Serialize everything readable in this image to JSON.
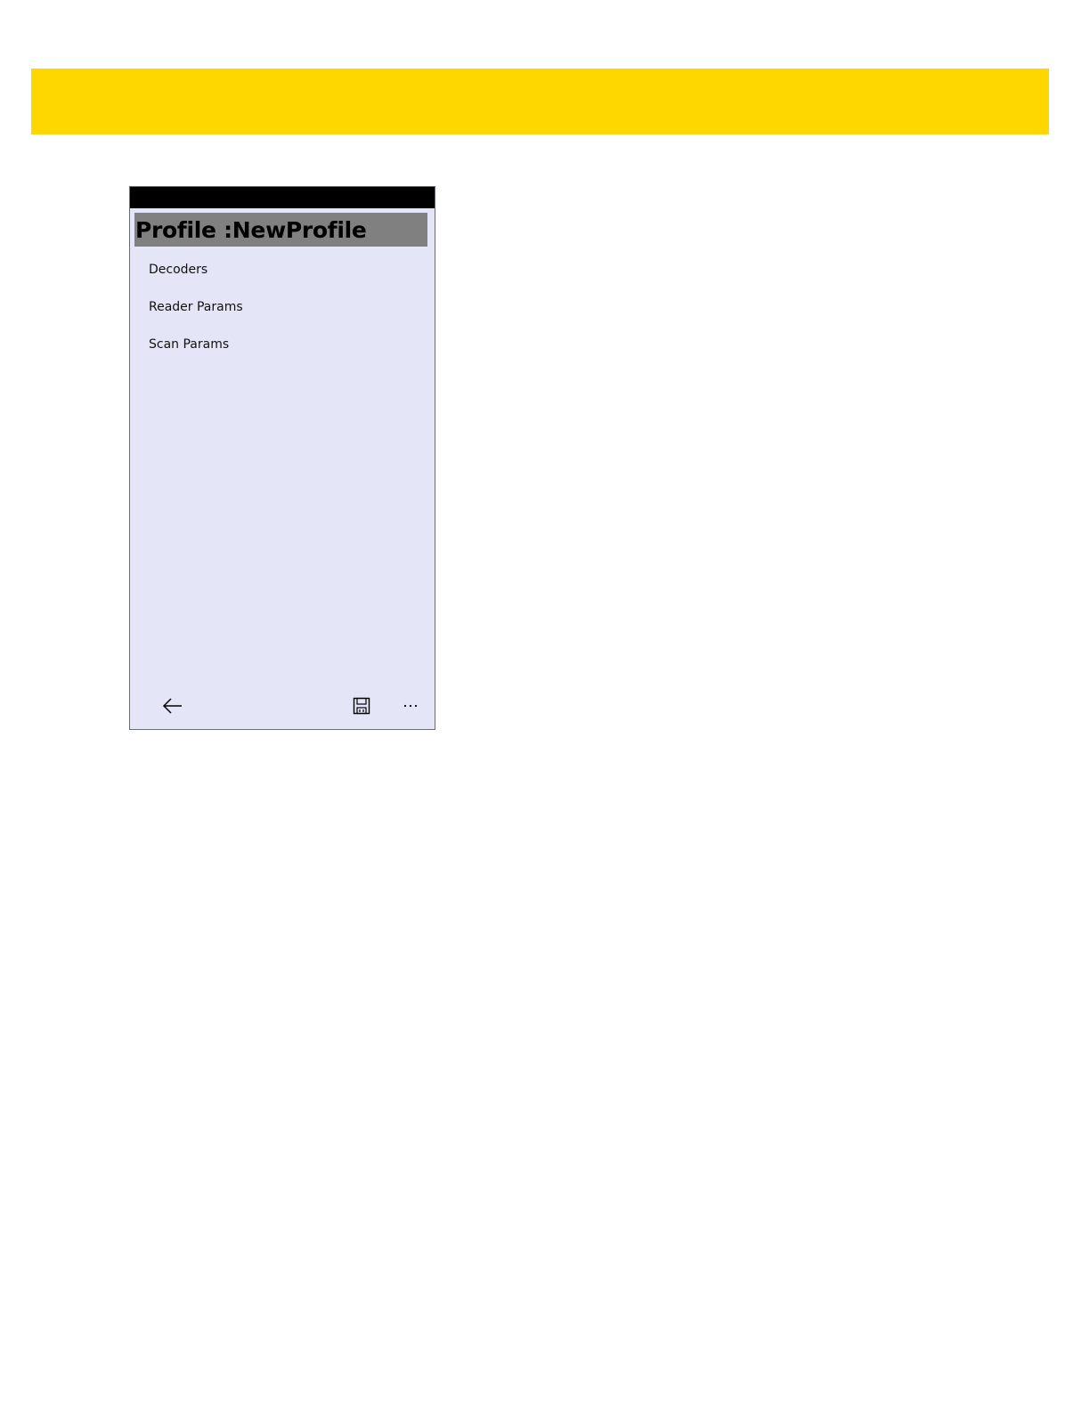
{
  "page": {
    "header_bar_color": "#FFD700"
  },
  "phone": {
    "background_color": "#E4E6F8",
    "title_background_color": "#808080",
    "title": "Profile :NewProfile",
    "menu": {
      "items": [
        {
          "label": "Decoders"
        },
        {
          "label": "Reader Params"
        },
        {
          "label": "Scan Params"
        }
      ]
    },
    "app_bar": {
      "back_icon": "arrow-left-icon",
      "save_icon": "floppy-disk-icon",
      "more_icon": "ellipsis-icon"
    }
  }
}
